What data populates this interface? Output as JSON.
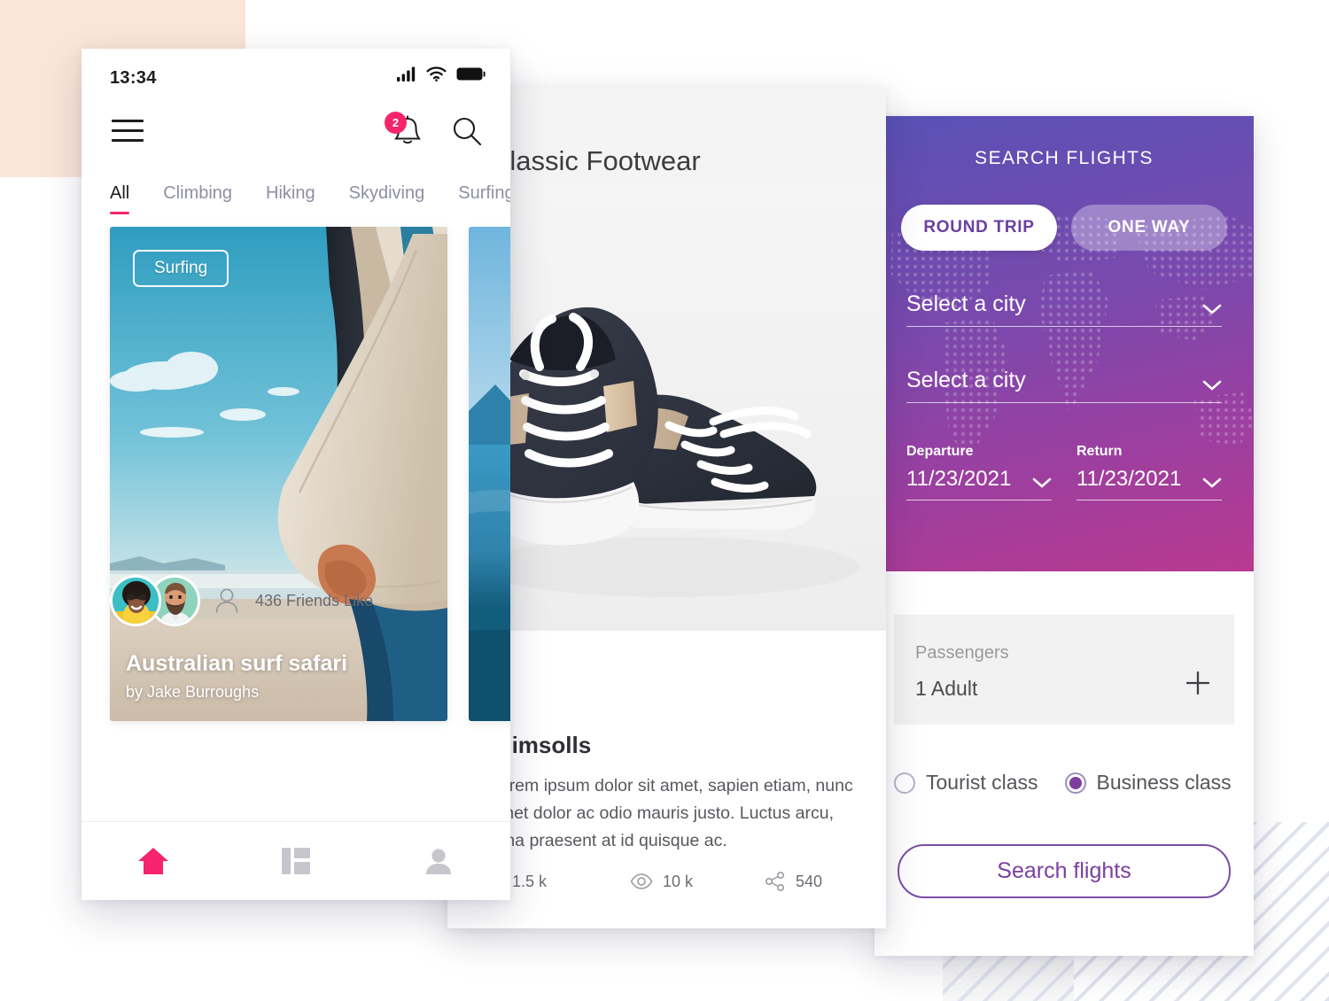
{
  "phone": {
    "statusbar": {
      "time": "13:34",
      "icons": [
        "signal-icon",
        "wifi-icon",
        "battery-icon"
      ]
    },
    "appbar": {
      "menu_icon": "hamburger-menu-icon",
      "bell_icon": "notification-bell-icon",
      "bell_badge": "2",
      "search_icon": "search-icon"
    },
    "tabs": [
      {
        "label": "All",
        "active": true
      },
      {
        "label": "Climbing",
        "active": false
      },
      {
        "label": "Hiking",
        "active": false
      },
      {
        "label": "Skydiving",
        "active": false
      },
      {
        "label": "Surfing",
        "active": false
      }
    ],
    "feed_card": {
      "category_badge": "Surfing",
      "title": "Australian surf safari",
      "byline": "by Jake Burroughs"
    },
    "friends": {
      "person_icon": "person-outline-icon",
      "count_label": "436 Friends Like"
    },
    "bottom_nav": [
      {
        "icon": "home-icon",
        "active": true
      },
      {
        "icon": "dashboard-grid-icon",
        "active": false
      },
      {
        "icon": "profile-person-icon",
        "active": false
      }
    ]
  },
  "product": {
    "header_title": "Classic Footwear",
    "name": "Plimsolls",
    "description": "Lorem ipsum dolor sit amet, sapien etiam, nunc amet dolor ac odio mauris justo. Luctus arcu, urna praesent at id quisque ac.",
    "stats": [
      {
        "icon": "heart-icon",
        "value": "1.5 k"
      },
      {
        "icon": "eye-icon",
        "value": "10 k"
      },
      {
        "icon": "share-icon",
        "value": "540"
      }
    ]
  },
  "flights": {
    "title": "SEARCH FLIGHTS",
    "trip_types": [
      {
        "label": "ROUND TRIP",
        "active": true
      },
      {
        "label": "ONE WAY",
        "active": false
      }
    ],
    "origin": {
      "value": "Select a city",
      "chevron": "chevron-down-icon"
    },
    "destination": {
      "value": "Select a city",
      "chevron": "chevron-down-icon"
    },
    "departure": {
      "label": "Departure",
      "value": "11/23/2021",
      "chevron": "chevron-down-icon"
    },
    "return": {
      "label": "Return",
      "value": "11/23/2021",
      "chevron": "chevron-down-icon"
    },
    "passengers": {
      "label": "Passengers",
      "value": "1 Adult",
      "add_icon": "plus-icon"
    },
    "classes": [
      {
        "label": "Tourist class",
        "selected": false
      },
      {
        "label": "Business class",
        "selected": true
      }
    ],
    "search_button": "Search flights"
  },
  "colors": {
    "accent_pink": "#f5246c",
    "purple": "#7b3fa0",
    "gradient_top": "#5a51b6",
    "gradient_bottom": "#b8398f",
    "peach": "#fbe5d8",
    "stripe": "#dfe3ee"
  }
}
